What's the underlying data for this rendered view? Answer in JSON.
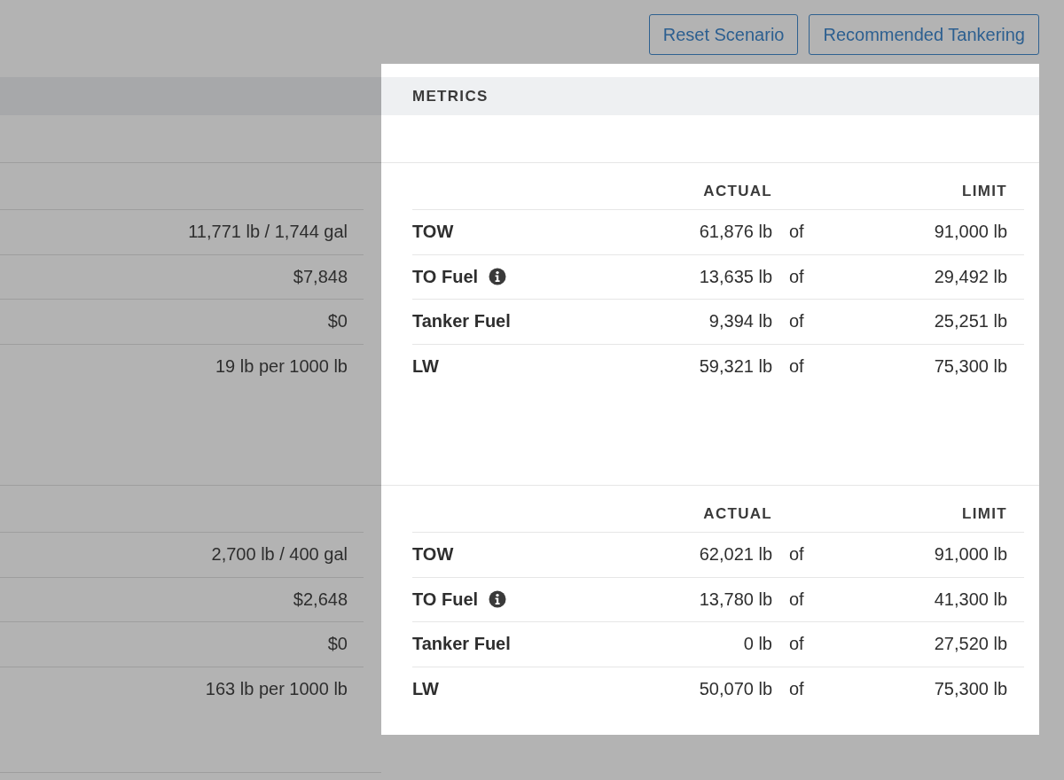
{
  "buttons": [
    {
      "label": "Reset Scenario"
    },
    {
      "label": "Recommended Tankering"
    }
  ],
  "metrics": {
    "title": "METRICS",
    "sections": [
      {
        "summary_values": [
          "11,771 lb / 1,744 gal",
          "$7,848",
          "$0",
          "19 lb per 1000 lb"
        ],
        "columns": [
          "ACTUAL",
          "LIMIT"
        ],
        "rows": [
          {
            "label": "TOW",
            "info": false,
            "actual": "61,876 lb",
            "of": "of",
            "limit": "91,000 lb"
          },
          {
            "label": "TO Fuel",
            "info": true,
            "actual": "13,635 lb",
            "of": "of",
            "limit": "29,492 lb"
          },
          {
            "label": "Tanker Fuel",
            "info": false,
            "actual": "9,394 lb",
            "of": "of",
            "limit": "25,251 lb"
          },
          {
            "label": "LW",
            "info": false,
            "actual": "59,321 lb",
            "of": "of",
            "limit": "75,300 lb"
          }
        ]
      },
      {
        "summary_values": [
          "2,700 lb / 400 gal",
          "$2,648",
          "$0",
          "163 lb per 1000 lb"
        ],
        "columns": [
          "ACTUAL",
          "LIMIT"
        ],
        "rows": [
          {
            "label": "TOW",
            "info": false,
            "actual": "62,021 lb",
            "of": "of",
            "limit": "91,000 lb"
          },
          {
            "label": "TO Fuel",
            "info": true,
            "actual": "13,780 lb",
            "of": "of",
            "limit": "41,300 lb"
          },
          {
            "label": "Tanker Fuel",
            "info": false,
            "actual": "0 lb",
            "of": "of",
            "limit": "27,520 lb"
          },
          {
            "label": "LW",
            "info": false,
            "actual": "50,070 lb",
            "of": "of",
            "limit": "75,300 lb"
          }
        ]
      }
    ]
  }
}
